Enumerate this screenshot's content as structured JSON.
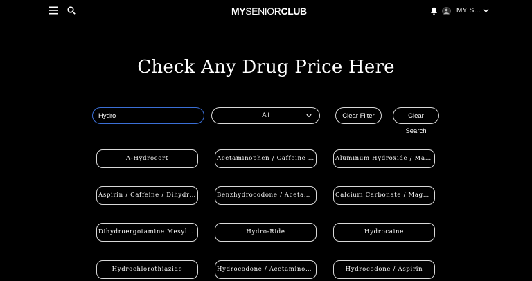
{
  "header": {
    "logo": {
      "my": "MY",
      "senior": "SENIOR",
      "club": "CLUB"
    },
    "user_name": "MY S...",
    "icons": [
      "menu-icon",
      "search-icon",
      "bell-icon",
      "avatar",
      "chevron-down-icon"
    ]
  },
  "page_title": "Check Any Drug Price Here",
  "filters": {
    "search_value": "Hydro",
    "category_value": "All",
    "clear_filter_label": "Clear Filter",
    "clear_search_label": "Clear Search"
  },
  "drugs": [
    "A-Hydrocort",
    "Acetaminophen / Caffeine / Dihydrocodeine",
    "Aluminum Hydroxide / Magnesium Hydroxide",
    "Aspirin / Caffeine / Dihydrocodeine",
    "Benzhydrocodone / Acetaminophen",
    "Calcium Carbonate / Magnesium Hydroxide",
    "Dihydroergotamine Mesylate",
    "Hydro-Ride",
    "Hydrocaine",
    "Hydrochlorothiazide",
    "Hydrocodone / Acetaminophen",
    "Hydrocodone / Aspirin"
  ],
  "colors": {
    "background": "#000000",
    "text": "#ffffff",
    "border": "#d9d9d9",
    "input_focus": "#3b6fd6"
  }
}
